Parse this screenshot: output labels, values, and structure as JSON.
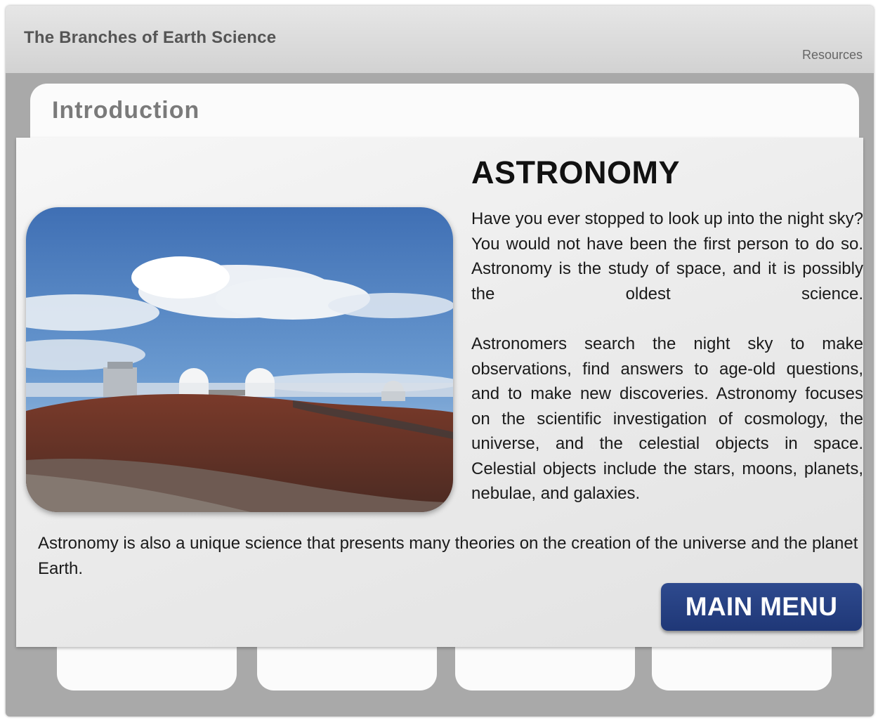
{
  "header": {
    "title": "The Branches of Earth Science",
    "resources_label": "Resources"
  },
  "section": {
    "title": "Introduction"
  },
  "main": {
    "heading": "ASTRONOMY",
    "paragraph_1": "Have you ever stopped to look up into the night sky? You would not have been the first person to do so. Astronomy is the study of space, and it is possibly the oldest science.",
    "paragraph_2": "Astronomers search the night sky to make observations, find answers to age-old questions, and to make new discoveries. Astronomy focuses on the scientific investigation of cosmology, the universe, and the celestial objects in space. Celestial objects include the stars, moons, planets, nebulae, and galaxies.",
    "paragraph_3": "Astronomy is also a unique science that presents many theories on the creation of the universe and the planet Earth.",
    "photo_icon": "observatory-photo",
    "main_menu_label": "MAIN MENU"
  },
  "bottom_tabs": [
    {
      "label": ""
    },
    {
      "label": ""
    },
    {
      "label": ""
    },
    {
      "label": ""
    }
  ],
  "colors": {
    "button_blue": "#243f82",
    "frame_gray": "#a9a9a9",
    "panel_light": "#f7f7f7"
  }
}
